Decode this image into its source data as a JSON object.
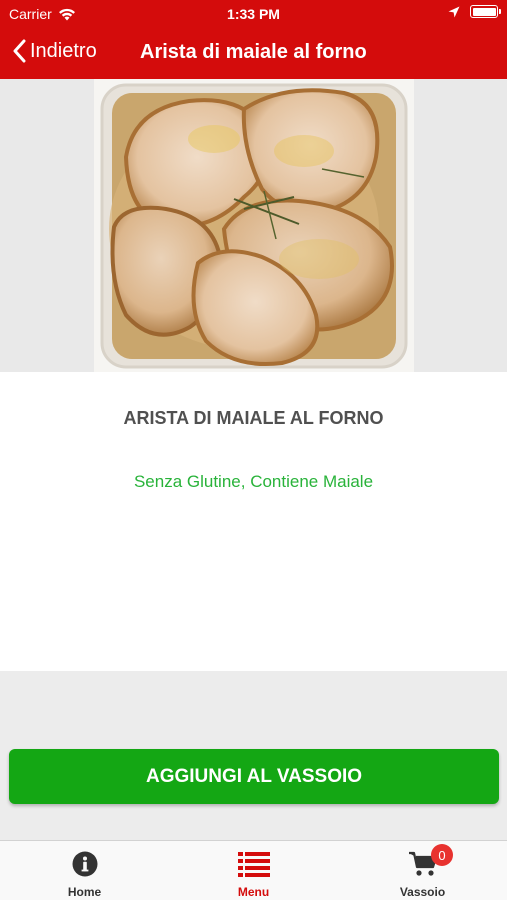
{
  "status_bar": {
    "carrier": "Carrier",
    "time": "1:33 PM"
  },
  "nav": {
    "back_label": "Indietro",
    "title": "Arista di maiale al forno"
  },
  "product": {
    "name": "ARISTA DI MAIALE AL FORNO",
    "tags": "Senza Glutine, Contiene Maiale",
    "image_icon": "roast-pork-photo"
  },
  "add_button": {
    "label": "AGGIUNGI AL VASSOIO"
  },
  "tabbar": {
    "tabs": [
      {
        "label": "Home",
        "icon": "info-icon"
      },
      {
        "label": "Menu",
        "icon": "menu-list-icon"
      },
      {
        "label": "Vassoio",
        "icon": "cart-icon"
      }
    ],
    "cart_count": "0"
  },
  "colors": {
    "brand_red": "#d40c0c",
    "add_green": "#14a714",
    "tag_green": "#29b33a",
    "badge_red": "#e8322f"
  }
}
